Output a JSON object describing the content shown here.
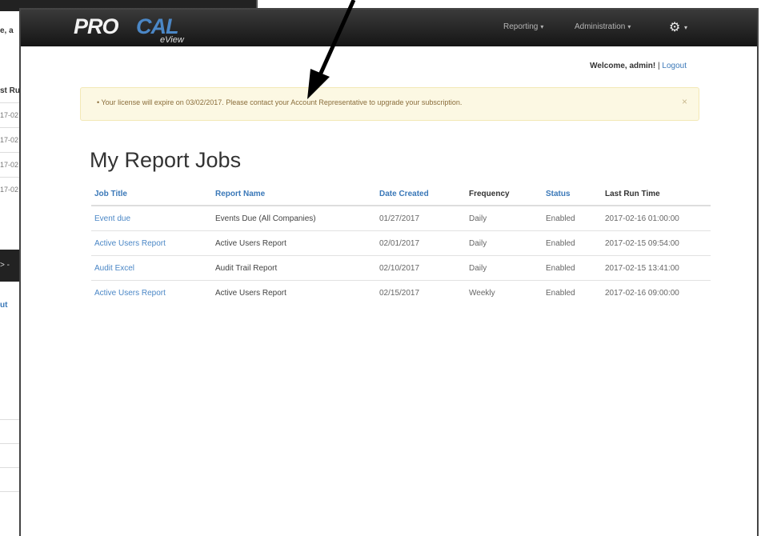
{
  "background_window": {
    "welcome_fragment": "e, a",
    "column_fragment": "st Ru",
    "row_fragments": [
      "17-02",
      "17-02",
      "17-02",
      "17-02"
    ],
    "gear_fragment": "> -",
    "logout_fragment": "ut"
  },
  "app": {
    "logo_pro": "PRO",
    "logo_cal": "CAL",
    "logo_eview": "eView"
  },
  "navbar": {
    "reporting_label": "Reporting",
    "administration_label": "Administration",
    "settings_icon": "gear-icon"
  },
  "user_bar": {
    "welcome_text": "Welcome, admin!",
    "separator": "|",
    "logout_label": "Logout"
  },
  "alert": {
    "message": "• Your license will expire on 03/02/2017. Please contact your Account Representative to upgrade your subscription.",
    "close_label": "×"
  },
  "page": {
    "title": "My Report Jobs"
  },
  "table": {
    "headers": {
      "job_title": "Job Title",
      "report_name": "Report Name",
      "date_created": "Date Created",
      "frequency": "Frequency",
      "status": "Status",
      "last_run_time": "Last Run Time"
    },
    "rows": [
      {
        "job_title": "Event due",
        "report_name": "Events Due (All Companies)",
        "date_created": "01/27/2017",
        "frequency": "Daily",
        "status": "Enabled",
        "last_run_time": "2017-02-16 01:00:00"
      },
      {
        "job_title": "Active Users Report",
        "report_name": "Active Users Report",
        "date_created": "02/01/2017",
        "frequency": "Daily",
        "status": "Enabled",
        "last_run_time": "2017-02-15 09:54:00"
      },
      {
        "job_title": "Audit Excel",
        "report_name": "Audit Trail Report",
        "date_created": "02/10/2017",
        "frequency": "Daily",
        "status": "Enabled",
        "last_run_time": "2017-02-15 13:41:00"
      },
      {
        "job_title": "Active Users Report",
        "report_name": "Active Users Report",
        "date_created": "02/15/2017",
        "frequency": "Weekly",
        "status": "Enabled",
        "last_run_time": "2017-02-16 09:00:00"
      }
    ]
  },
  "colors": {
    "navbar_dark": "#1e1e1e",
    "link_blue": "#3a78b8",
    "alert_bg": "#fcf8e3",
    "alert_text": "#8a6d3b"
  }
}
